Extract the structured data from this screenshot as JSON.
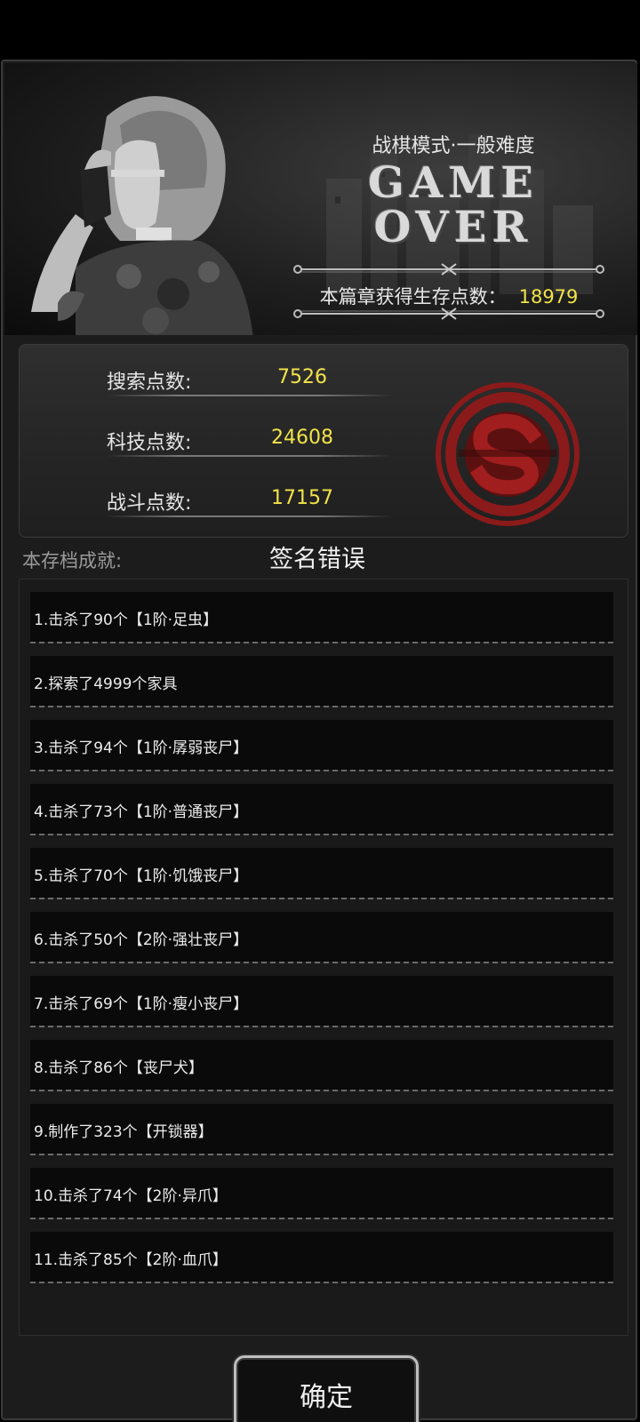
{
  "header": {
    "mode": "战棋模式·一般难度",
    "title_line1": "GAME",
    "title_line2": "OVER",
    "points_label": "本篇章获得生存点数：",
    "points_value": "18979"
  },
  "stats": {
    "search_label": "搜索点数:",
    "search_value": "7526",
    "tech_label": "科技点数:",
    "tech_value": "24608",
    "combat_label": "战斗点数:",
    "combat_value": "17157",
    "seal_icon": "red-s-seal-icon"
  },
  "achievements": {
    "label": "本存档成就:",
    "status": "签名错误",
    "items": [
      "1.击杀了90个【1阶·足虫】",
      "2.探索了4999个家具",
      "3.击杀了94个【1阶·孱弱丧尸】",
      "4.击杀了73个【1阶·普通丧尸】",
      "5.击杀了70个【1阶·饥饿丧尸】",
      "6.击杀了50个【2阶·强壮丧尸】",
      "7.击杀了69个【1阶·瘦小丧尸】",
      "8.击杀了86个【丧尸犬】",
      "9.制作了323个【开锁器】",
      "10.击杀了74个【2阶·异爪】",
      "11.击杀了85个【2阶·血爪】"
    ]
  },
  "footer": {
    "confirm_label": "确定"
  },
  "colors": {
    "accent_yellow": "#f2e34a",
    "seal_red": "#8b1a1a"
  }
}
